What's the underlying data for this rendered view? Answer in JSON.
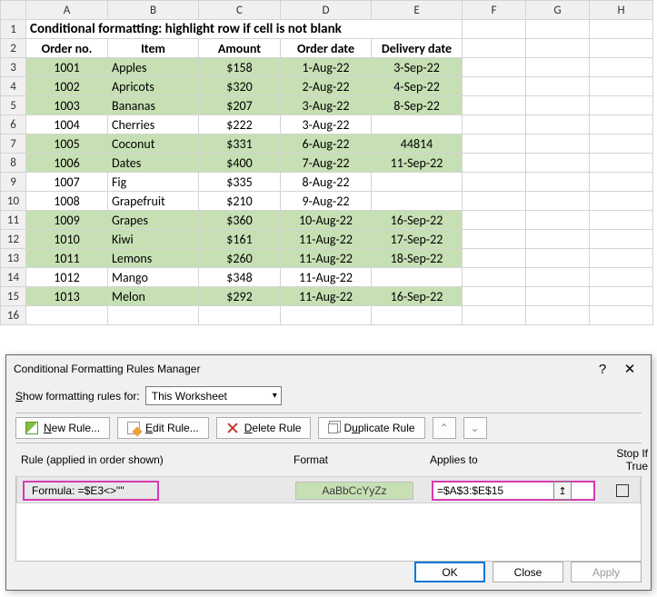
{
  "columns": [
    "A",
    "B",
    "C",
    "D",
    "E",
    "F",
    "G",
    "H"
  ],
  "title": "Conditional formatting: highlight row if cell is not blank",
  "headers": {
    "a": "Order no.",
    "b": "Item",
    "c": "Amount",
    "d": "Order date",
    "e": "Delivery date"
  },
  "rows": [
    {
      "n": 3,
      "hl": true,
      "a": "1001",
      "b": "Apples",
      "c": "$158",
      "d": "1-Aug-22",
      "e": "3-Sep-22"
    },
    {
      "n": 4,
      "hl": true,
      "a": "1002",
      "b": "Apricots",
      "c": "$320",
      "d": "2-Aug-22",
      "e": "4-Sep-22"
    },
    {
      "n": 5,
      "hl": true,
      "a": "1003",
      "b": "Bananas",
      "c": "$207",
      "d": "3-Aug-22",
      "e": "8-Sep-22"
    },
    {
      "n": 6,
      "hl": false,
      "a": "1004",
      "b": "Cherries",
      "c": "$222",
      "d": "3-Aug-22",
      "e": ""
    },
    {
      "n": 7,
      "hl": true,
      "a": "1005",
      "b": "Coconut",
      "c": "$331",
      "d": "6-Aug-22",
      "e": "44814"
    },
    {
      "n": 8,
      "hl": true,
      "a": "1006",
      "b": "Dates",
      "c": "$400",
      "d": "7-Aug-22",
      "e": "11-Sep-22"
    },
    {
      "n": 9,
      "hl": false,
      "a": "1007",
      "b": "Fig",
      "c": "$335",
      "d": "8-Aug-22",
      "e": ""
    },
    {
      "n": 10,
      "hl": false,
      "a": "1008",
      "b": "Grapefruit",
      "c": "$210",
      "d": "9-Aug-22",
      "e": ""
    },
    {
      "n": 11,
      "hl": true,
      "a": "1009",
      "b": "Grapes",
      "c": "$360",
      "d": "10-Aug-22",
      "e": "16-Sep-22"
    },
    {
      "n": 12,
      "hl": true,
      "a": "1010",
      "b": "Kiwi",
      "c": "$161",
      "d": "11-Aug-22",
      "e": "17-Sep-22"
    },
    {
      "n": 13,
      "hl": true,
      "a": "1011",
      "b": "Lemons",
      "c": "$260",
      "d": "11-Aug-22",
      "e": "18-Sep-22"
    },
    {
      "n": 14,
      "hl": false,
      "a": "1012",
      "b": "Mango",
      "c": "$348",
      "d": "11-Aug-22",
      "e": ""
    },
    {
      "n": 15,
      "hl": true,
      "a": "1013",
      "b": "Melon",
      "c": "$292",
      "d": "11-Aug-22",
      "e": "16-Sep-22"
    }
  ],
  "blank_row": 16,
  "dialog": {
    "title": "Conditional Formatting Rules Manager",
    "show_label_pre": "S",
    "show_label_post": "how formatting rules for:",
    "scope": "This Worksheet",
    "buttons": {
      "new_u": "N",
      "new_rest": "ew Rule...",
      "edit_u": "E",
      "edit_rest": "dit Rule...",
      "del_u": "D",
      "del_rest": "elete Rule",
      "dup_pre": "D",
      "dup_u": "u",
      "dup_rest": "plicate Rule"
    },
    "cols": {
      "rule": "Rule (applied in order shown)",
      "format": "Format",
      "applies": "Applies to",
      "stop": "Stop If True"
    },
    "rule": {
      "label": "Formula: =$E3<>\"\"",
      "sample": "AaBbCcYyZz",
      "range": "=$A$3:$E$15"
    },
    "footer": {
      "ok": "OK",
      "close": "Close",
      "apply": "Apply"
    }
  }
}
